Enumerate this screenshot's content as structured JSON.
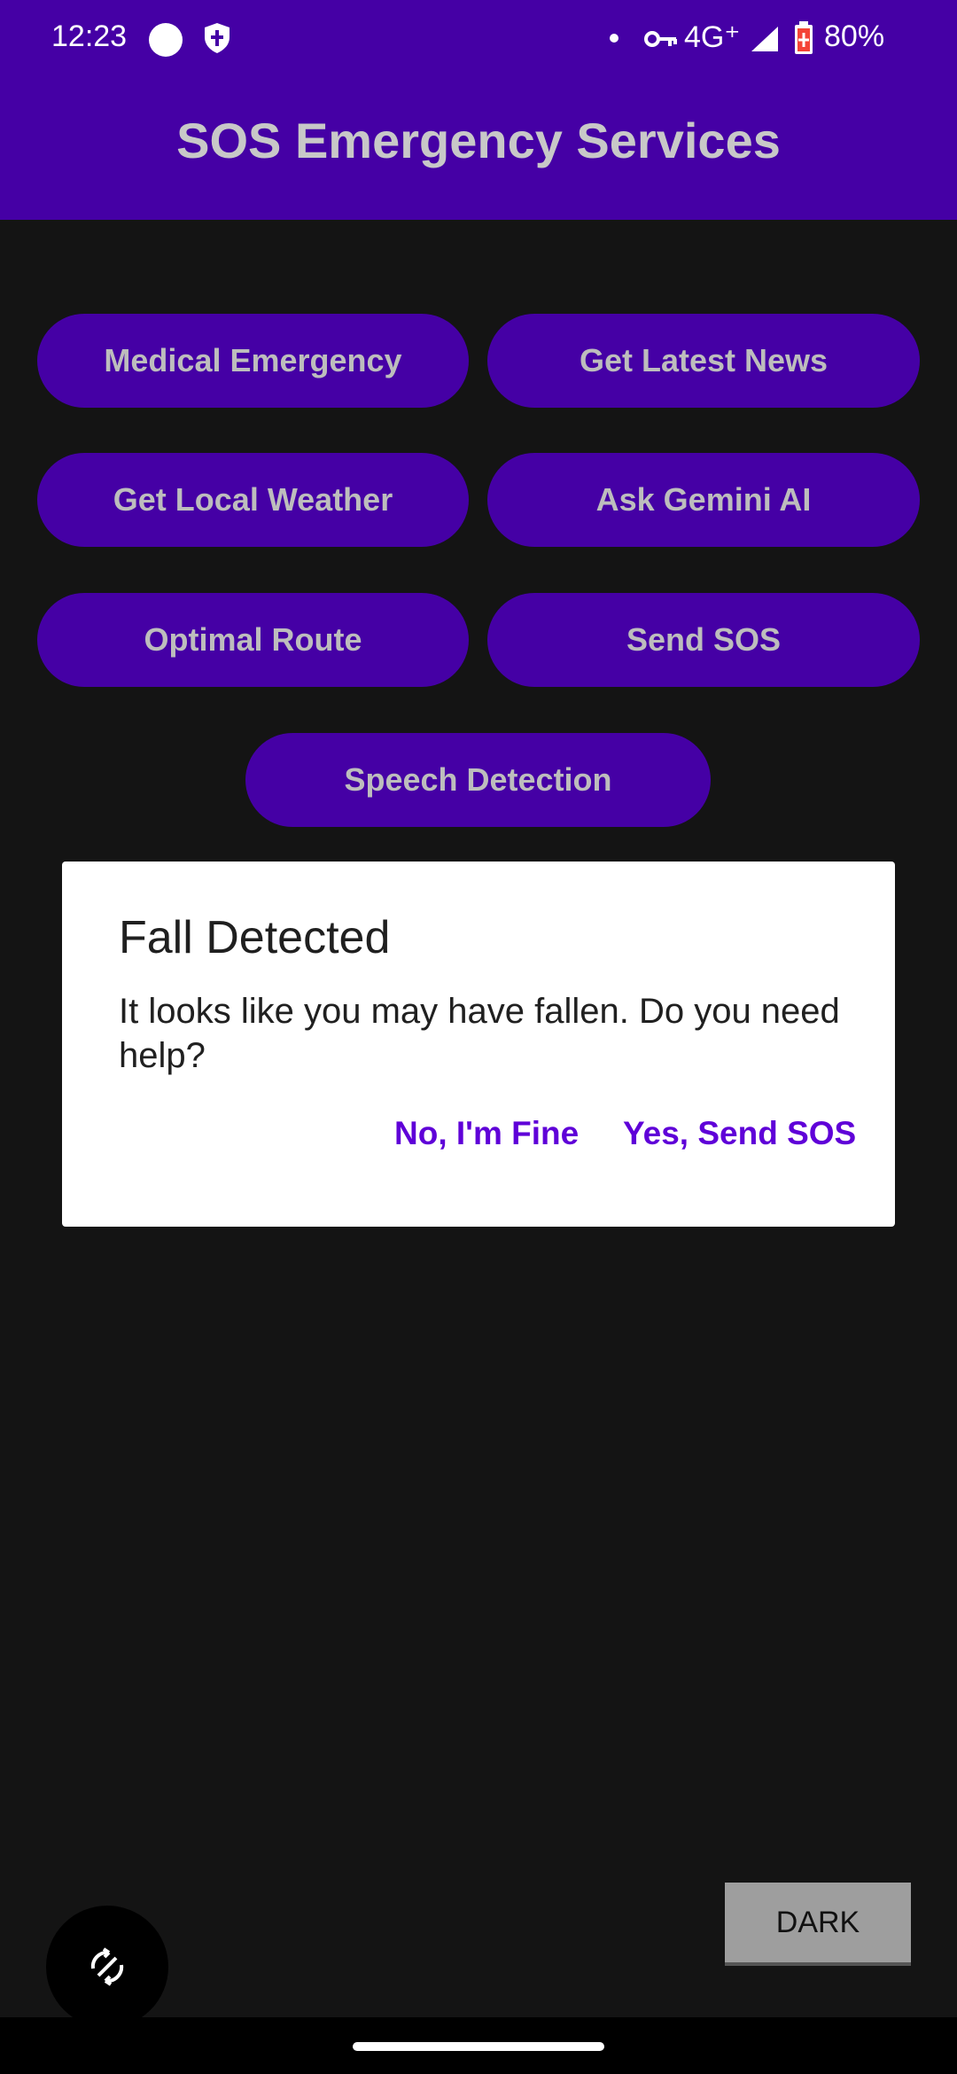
{
  "status_bar": {
    "time": "12:23",
    "network": "4G⁺",
    "battery": "80%",
    "icons": [
      "circle-icon",
      "shield-icon",
      "key-icon",
      "signal-icon",
      "battery-icon"
    ]
  },
  "app_bar": {
    "title": "SOS Emergency Services"
  },
  "buttons": {
    "medical": "Medical Emergency",
    "news": "Get Latest News",
    "weather": "Get Local Weather",
    "gemini": "Ask Gemini AI",
    "route": "Optimal Route",
    "sos": "Send SOS",
    "speech": "Speech Detection"
  },
  "dialog": {
    "title": "Fall Detected",
    "message": "It looks like you may have fallen. Do you need help?",
    "negative": "No, I'm Fine",
    "positive": "Yes, Send SOS"
  },
  "theme_toggle": {
    "label": "DARK"
  },
  "colors": {
    "primary": "#4500A5",
    "background": "#141414",
    "dialog_action": "#5F00D8"
  }
}
